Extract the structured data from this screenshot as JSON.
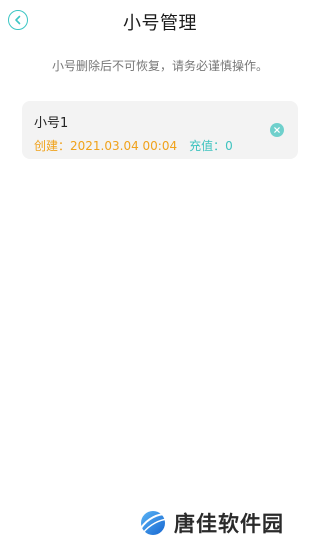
{
  "header": {
    "title": "小号管理"
  },
  "notice": "小号删除后不可恢复，请务必谨慎操作。",
  "accounts": [
    {
      "name": "小号1",
      "created_label": "创建：",
      "created": "2021.03.04 00:04",
      "recharge_label": "充值：",
      "recharge": "0"
    }
  ],
  "watermark": {
    "text": "唐佳软件园"
  },
  "colors": {
    "accent": "#3cc6c4",
    "created": "#f0a21b",
    "recharge": "#3ec3bf",
    "card_bg": "#f3f3f3"
  }
}
